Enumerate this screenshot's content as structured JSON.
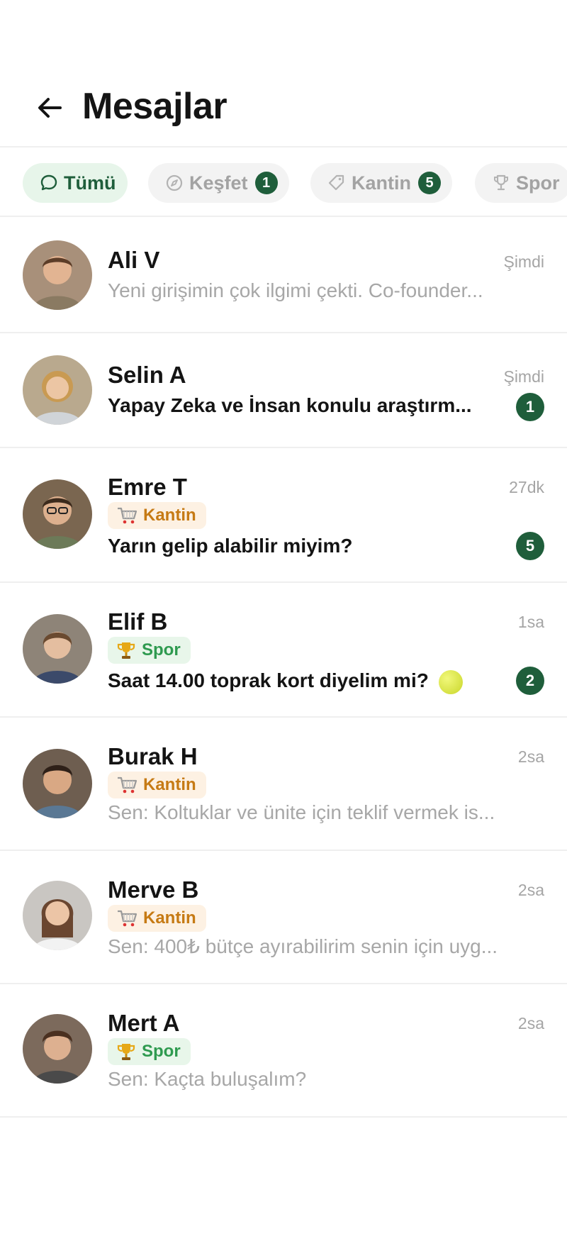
{
  "header": {
    "title": "Mesajlar"
  },
  "filters": [
    {
      "label": "Tümü",
      "icon": "chat-bubble-icon",
      "count": null,
      "active": true
    },
    {
      "label": "Keşfet",
      "icon": "compass-icon",
      "count": "1",
      "active": false
    },
    {
      "label": "Kantin",
      "icon": "tag-icon",
      "count": "5",
      "active": false
    },
    {
      "label": "Spor",
      "icon": "trophy-icon",
      "count": null,
      "active": false
    }
  ],
  "conversations": [
    {
      "name": "Ali V",
      "time": "Şimdi",
      "tag": null,
      "preview": "Yeni girişimin çok ilgimi çekti. Co-founder...",
      "unread": null
    },
    {
      "name": "Selin A",
      "time": "Şimdi",
      "tag": null,
      "preview": "Yapay Zeka ve İnsan konulu araştırm...",
      "unread": "1"
    },
    {
      "name": "Emre T",
      "time": "27dk",
      "tag": "Kantin",
      "preview": "Yarın gelip alabilir miyim?",
      "unread": "5"
    },
    {
      "name": "Elif B",
      "time": "1sa",
      "tag": "Spor",
      "preview": "Saat 14.00 toprak kort diyelim mi?",
      "unread": "2"
    },
    {
      "name": "Burak H",
      "time": "2sa",
      "tag": "Kantin",
      "preview": "Sen: Koltuklar ve ünite için teklif vermek is...",
      "unread": null
    },
    {
      "name": "Merve B",
      "time": "2sa",
      "tag": "Kantin",
      "preview": "Sen: 400₺ bütçe ayırabilirim senin için uyg...",
      "unread": null
    },
    {
      "name": "Mert A",
      "time": "2sa",
      "tag": "Spor",
      "preview": "Sen: Kaçta buluşalım?",
      "unread": null
    }
  ],
  "colors": {
    "accent": "#1f5e3b",
    "active_chip_bg": "#e7f5ea",
    "kantin_bg": "#fdf1e3",
    "kantin_text": "#c67a14",
    "spor_bg": "#e8f6ea",
    "spor_text": "#2e9a4f"
  }
}
